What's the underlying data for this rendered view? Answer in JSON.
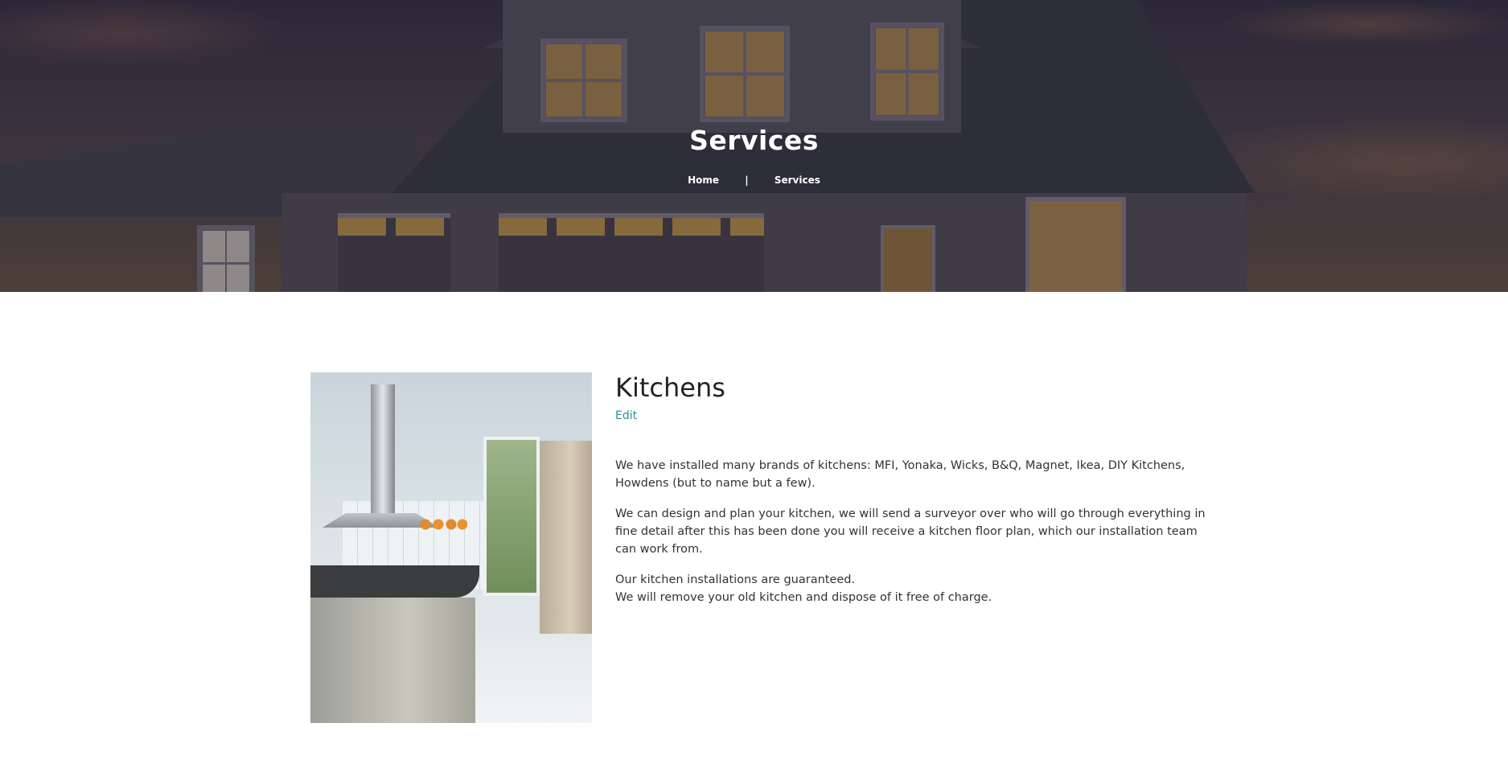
{
  "hero": {
    "title": "Services",
    "breadcrumb": {
      "home": "Home",
      "separator": "|",
      "current": "Services"
    }
  },
  "service": {
    "title": "Kitchens",
    "edit_label": "Edit",
    "paragraphs": [
      "We have installed many brands of kitchens: MFI, Yonaka, Wicks, B&Q, Magnet, Ikea, DIY Kitchens, Howdens (but to name but a few).",
      "We can design and plan your kitchen, we will send a surveyor over who will go through everything in fine detail after this has been done you will receive a kitchen floor plan, which our installation team can work from.",
      "Our kitchen installations are guaranteed.",
      "We will remove your old kitchen and dispose of it free of charge."
    ]
  },
  "colors": {
    "link": "#2b8ea0",
    "heading": "#222222",
    "body_text": "#333333"
  }
}
